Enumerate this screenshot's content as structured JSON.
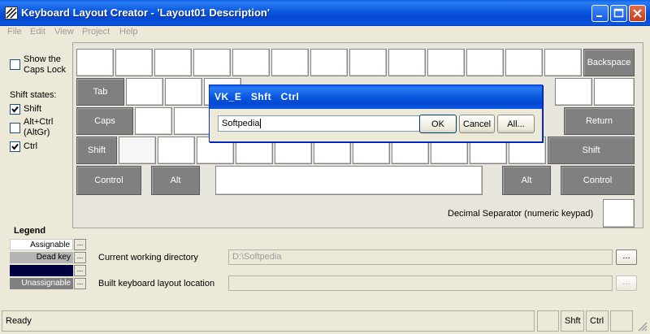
{
  "window": {
    "title": "Keyboard Layout Creator - 'Layout01 Description'",
    "icon": "keyboard-app-icon"
  },
  "menu": {
    "items": [
      "File",
      "Edit",
      "View",
      "Project",
      "Help"
    ]
  },
  "left_panel": {
    "show_caps_lock_label": "Show the Caps Lock",
    "show_caps_lock_checked": false,
    "shift_states_label": "Shift states:",
    "states": [
      {
        "label": "Shift",
        "checked": true
      },
      {
        "label": "Alt+Ctrl (AltGr)",
        "checked": false
      },
      {
        "label": "Ctrl",
        "checked": true
      }
    ]
  },
  "keyboard": {
    "backspace": "Backspace",
    "tab": "Tab",
    "caps": "Caps",
    "return": "Return",
    "shift_left": "Shift",
    "shift_right": "Shift",
    "control_left": "Control",
    "alt_left": "Alt",
    "alt_right": "Alt",
    "control_right": "Control",
    "decimal_separator_label": "Decimal Separator (numeric keypad)"
  },
  "dialog": {
    "title": "VK_E   Shft   Ctrl",
    "input_value": "Softpedia",
    "ok": "OK",
    "cancel": "Cancel",
    "all": "All..."
  },
  "legend": {
    "title": "Legend",
    "items": [
      {
        "label": "Assignable",
        "color": "#ffffff",
        "text_color": "#000000"
      },
      {
        "label": "Dead key",
        "color": "#b4b4b4",
        "text_color": "#000000"
      },
      {
        "label": "",
        "color": "#000040",
        "text_color": "#ffffff"
      },
      {
        "label": "Unassignable",
        "color": "#808080",
        "text_color": "#ffffff"
      }
    ],
    "button": "..."
  },
  "paths": {
    "working_dir_label": "Current working directory",
    "working_dir_value": "D:\\Softpedia",
    "build_location_label": "Built keyboard layout location",
    "build_location_value": "",
    "browse": "..."
  },
  "status": {
    "text": "Ready",
    "shift": "Shft",
    "ctrl": "Ctrl",
    "alt": ""
  },
  "colors": {
    "titlebar": "#0a58e0",
    "key_gray": "#808080",
    "window_bg": "#ece9d8"
  }
}
